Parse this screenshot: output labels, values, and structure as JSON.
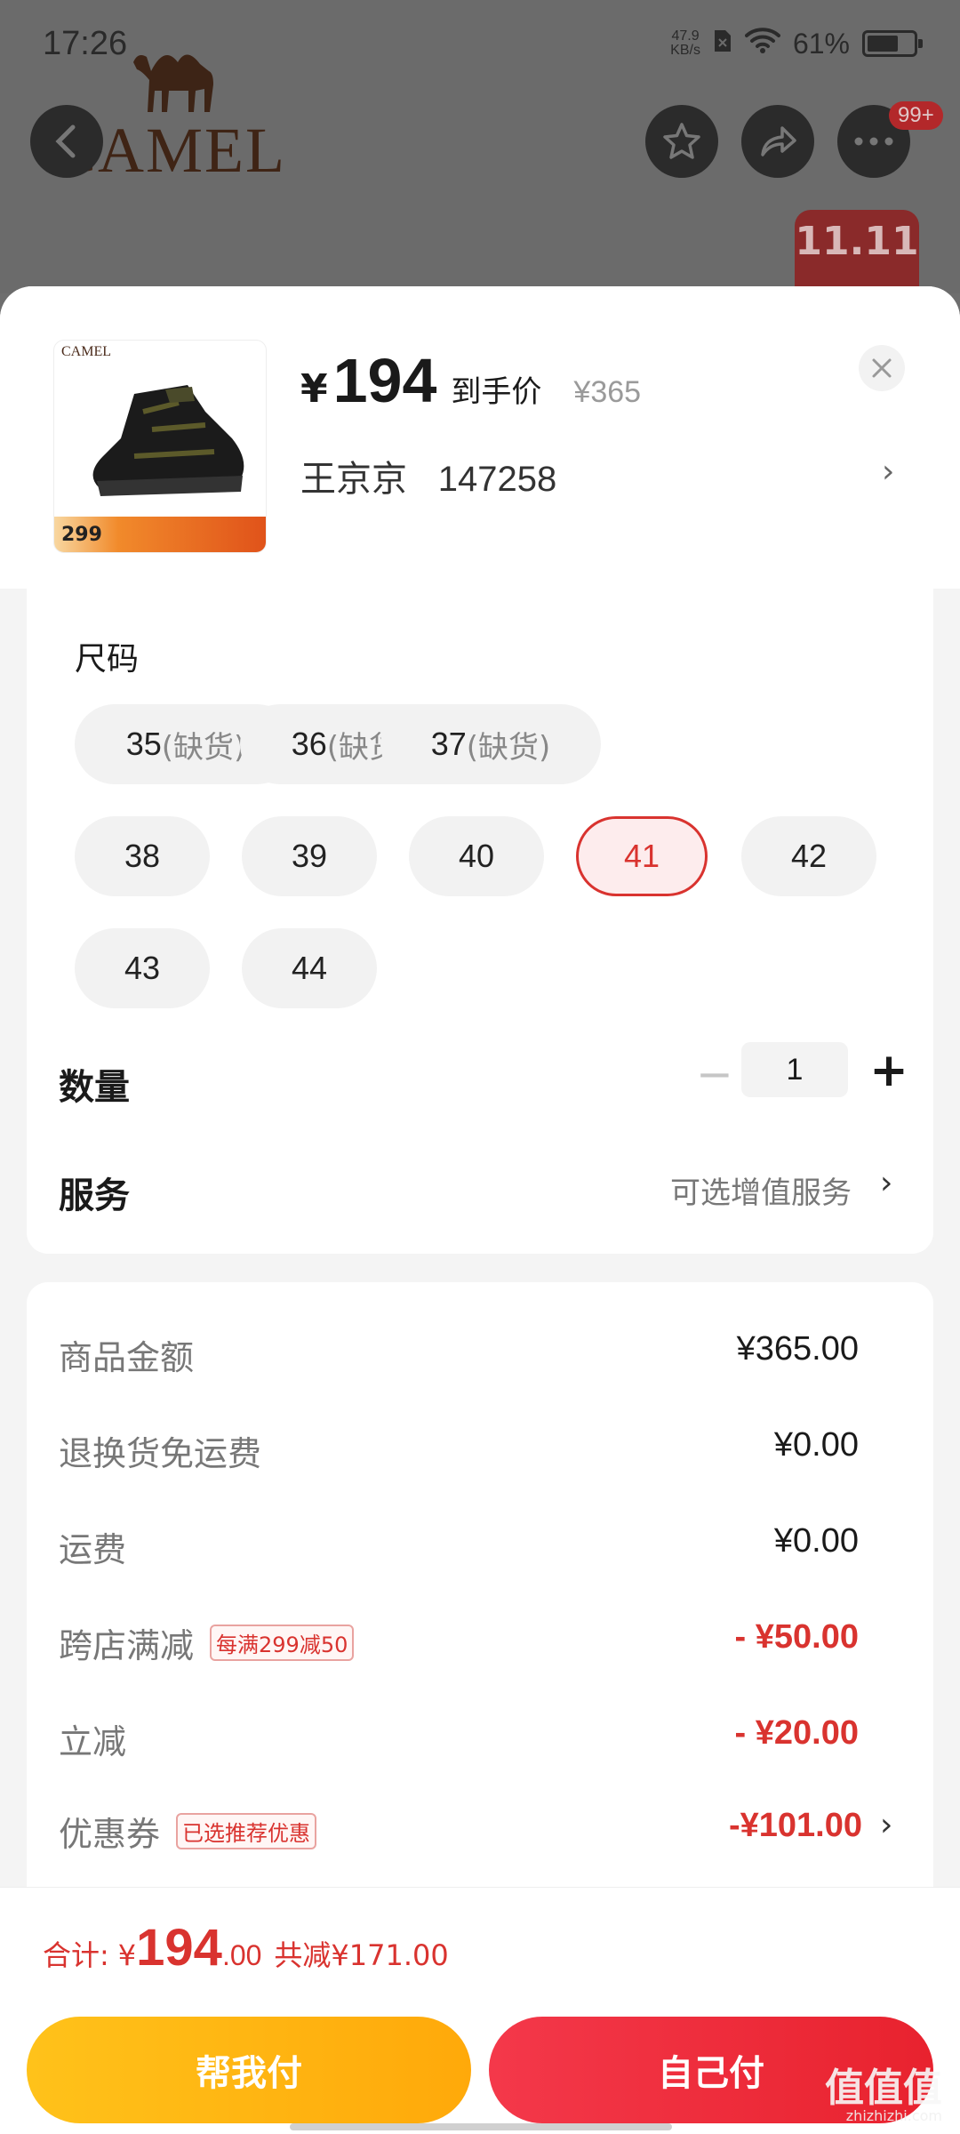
{
  "status": {
    "time": "17:26",
    "speed": "47.9\nKB/s",
    "battery": "61%"
  },
  "brand": {
    "name": "CAMEL"
  },
  "header": {
    "more_badge": "99+",
    "promo": "11.11"
  },
  "product": {
    "thumb_logo": "CAMEL",
    "thumb_price": "299",
    "price_currency": "¥",
    "price": "194",
    "price_label": "到手价",
    "original_price": "¥365"
  },
  "address": {
    "name": "王京京",
    "code": "147258"
  },
  "size": {
    "title": "尺码",
    "options": [
      {
        "value": "35",
        "note": "(缺货)"
      },
      {
        "value": "36",
        "note": "(缺货)"
      },
      {
        "value": "37",
        "note": "(缺货)"
      },
      {
        "value": "38",
        "note": ""
      },
      {
        "value": "39",
        "note": ""
      },
      {
        "value": "40",
        "note": ""
      },
      {
        "value": "41",
        "note": ""
      },
      {
        "value": "42",
        "note": ""
      },
      {
        "value": "43",
        "note": ""
      },
      {
        "value": "44",
        "note": ""
      }
    ],
    "selected": "41"
  },
  "quantity": {
    "label": "数量",
    "value": "1"
  },
  "service": {
    "label": "服务",
    "hint": "可选增值服务"
  },
  "breakdown": [
    {
      "label": "商品金额",
      "tag": "",
      "value": "¥365.00"
    },
    {
      "label": "退换货免运费",
      "tag": "",
      "value": "¥0.00"
    },
    {
      "label": "运费",
      "tag": "",
      "value": "¥0.00"
    },
    {
      "label": "跨店满减",
      "tag": "每满299减50",
      "value": "- ¥50.00"
    },
    {
      "label": "立减",
      "tag": "",
      "value": "- ¥20.00"
    },
    {
      "label": "优惠券",
      "tag": "已选推荐优惠",
      "value": "-¥101.00"
    }
  ],
  "total": {
    "label": "合计:",
    "currency": "¥",
    "integer": "194",
    "decimal": ".00",
    "saved": "共减¥171.00"
  },
  "actions": {
    "help_pay": "帮我付",
    "self_pay": "自己付"
  },
  "watermark": {
    "main": "值值值",
    "sub": "zhizhizhi.com"
  },
  "colors": {
    "accent_red": "#d9332f",
    "help_yellow": "#ffb414",
    "self_red": "#ee2d3c"
  }
}
